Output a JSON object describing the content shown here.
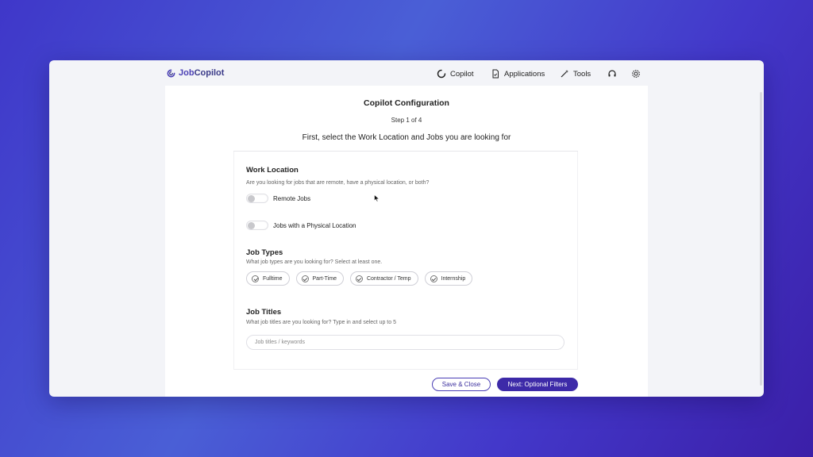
{
  "brand": {
    "prefix": "Job",
    "suffix": "Copilot"
  },
  "nav": {
    "copilot": "Copilot",
    "applications": "Applications",
    "tools": "Tools"
  },
  "header": {
    "title": "Copilot Configuration",
    "step": "Step 1 of 4",
    "subtitle": "First, select the Work Location and Jobs you are looking for"
  },
  "work_location": {
    "title": "Work Location",
    "description": "Are you looking for jobs that are remote, have a physical location, or both?",
    "options": [
      {
        "label": "Remote Jobs",
        "enabled": false
      },
      {
        "label": "Jobs with a Physical Location",
        "enabled": false
      }
    ]
  },
  "job_types": {
    "title": "Job Types",
    "description": "What job types are you looking for? Select at least one.",
    "chips": [
      "Fulltime",
      "Part-Time",
      "Contractor / Temp",
      "Internship"
    ]
  },
  "job_titles": {
    "title": "Job Titles",
    "description": "What job titles are you looking for? Type in and select up to 5",
    "placeholder": "Job titles / keywords"
  },
  "actions": {
    "save": "Save & Close",
    "next": "Next: Optional Filters"
  },
  "colors": {
    "accent": "#3d2aa8",
    "background": "#4338ca"
  }
}
